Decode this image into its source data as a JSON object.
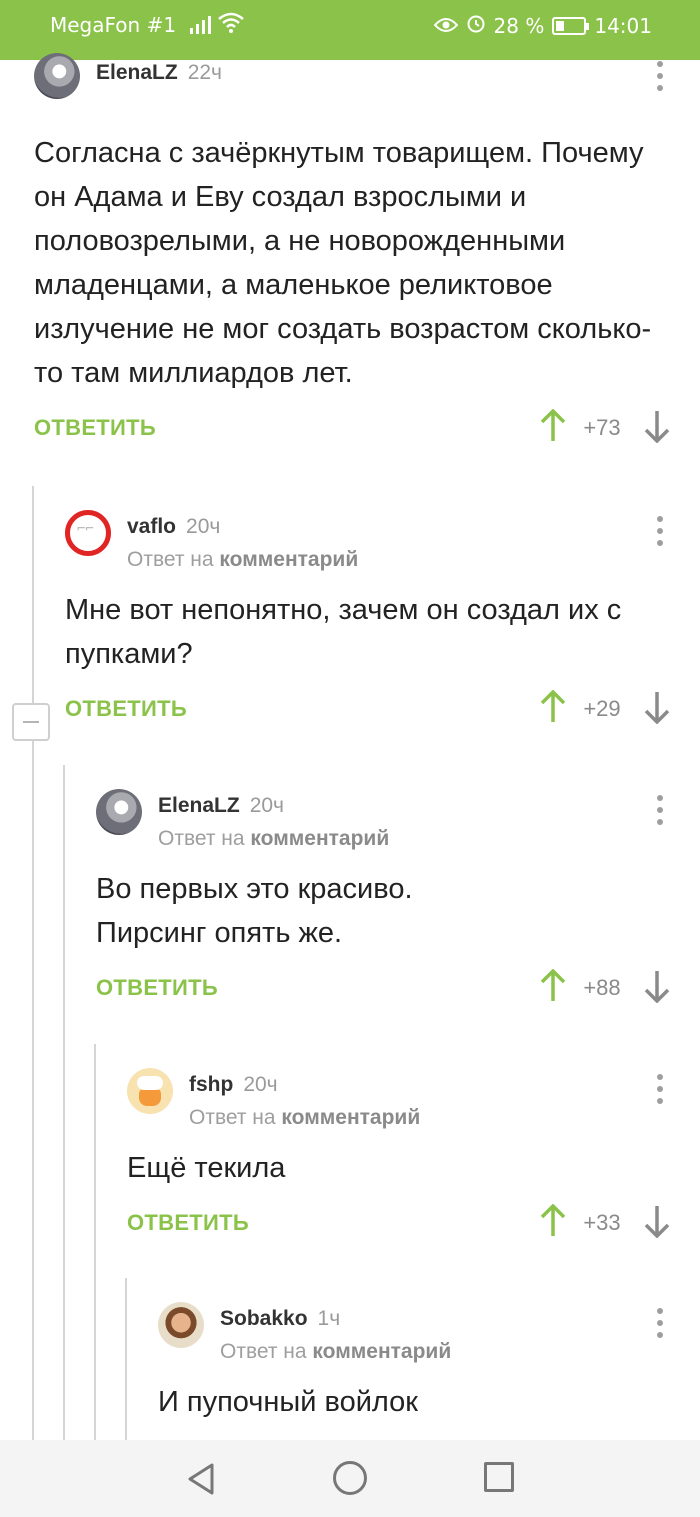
{
  "status_bar": {
    "carrier": "MegaFon #1",
    "battery": "28 %",
    "time": "14:01"
  },
  "comments": [
    {
      "author": "ElenaLZ",
      "time": "22ч",
      "reply_prefix": "",
      "reply_link": "",
      "text": "Согласна с зачёркнутым товарищем. Почему он Адама и Еву создал взрослыми и половозрелыми, а не новорожденными младенцами, а маленькое реликтовое излучение не мог создать возрастом сколько-то там миллиардов лет.",
      "reply_label": "ОТВЕТИТЬ",
      "rating": "+73"
    },
    {
      "author": "vaflo",
      "time": "20ч",
      "reply_prefix": "Ответ на ",
      "reply_link": "комментарий",
      "text": "Мне вот непонятно, зачем он создал их с пупками?",
      "reply_label": "ОТВЕТИТЬ",
      "rating": "+29"
    },
    {
      "author": "ElenaLZ",
      "time": "20ч",
      "reply_prefix": "Ответ на ",
      "reply_link": "комментарий",
      "text_lines": [
        "Во первых это красиво.",
        "Пирсинг опять же."
      ],
      "reply_label": "ОТВЕТИТЬ",
      "rating": "+88"
    },
    {
      "author": "fshp",
      "time": "20ч",
      "reply_prefix": "Ответ на ",
      "reply_link": "комментарий",
      "text": "Ещё текила",
      "reply_label": "ОТВЕТИТЬ",
      "rating": "+33"
    },
    {
      "author": "Sobakko",
      "time": "1ч",
      "reply_prefix": "Ответ на ",
      "reply_link": "комментарий",
      "text": "И пупочный войлок"
    }
  ],
  "colors": {
    "accent": "#8bc34a",
    "upvote": "#8bc34a",
    "downvote": "#8a8a8a"
  }
}
